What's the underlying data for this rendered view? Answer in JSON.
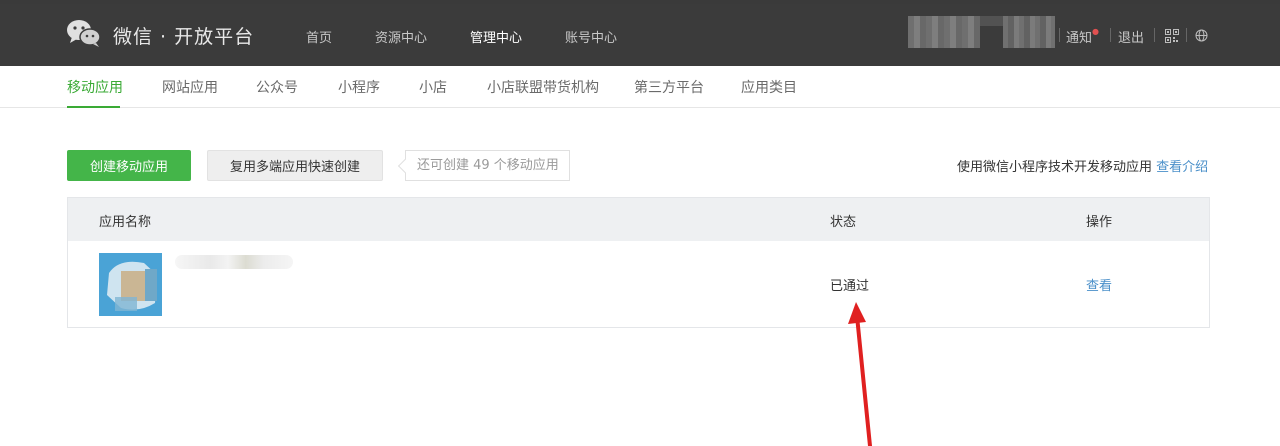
{
  "header": {
    "brand": "微信 · 开放平台",
    "nav": [
      "首页",
      "资源中心",
      "管理中心",
      "账号中心"
    ],
    "active_nav": "管理中心",
    "right": {
      "notice": "通知",
      "logout": "退出"
    },
    "icons": [
      "wechat-logo-icon",
      "qrcode-icon",
      "globe-icon"
    ]
  },
  "subnav": {
    "items": [
      "移动应用",
      "网站应用",
      "公众号",
      "小程序",
      "小店",
      "小店联盟带货机构",
      "第三方平台",
      "应用类目"
    ],
    "active": "移动应用"
  },
  "toolbar": {
    "create_label": "创建移动应用",
    "reuse_label": "复用多端应用快速创建",
    "quota_text": "还可创建 49 个移动应用",
    "intro_text": "使用微信小程序技术开发移动应用",
    "intro_link": "查看介绍"
  },
  "table": {
    "headers": [
      "应用名称",
      "状态",
      "操作"
    ],
    "rows": [
      {
        "name": "",
        "status": "已通过",
        "action": "查看"
      }
    ]
  },
  "colors": {
    "header_bg": "#3b3b3b",
    "accent_green": "#44b549",
    "link_blue": "#4a8fc9",
    "arrow_red": "#e02020"
  }
}
